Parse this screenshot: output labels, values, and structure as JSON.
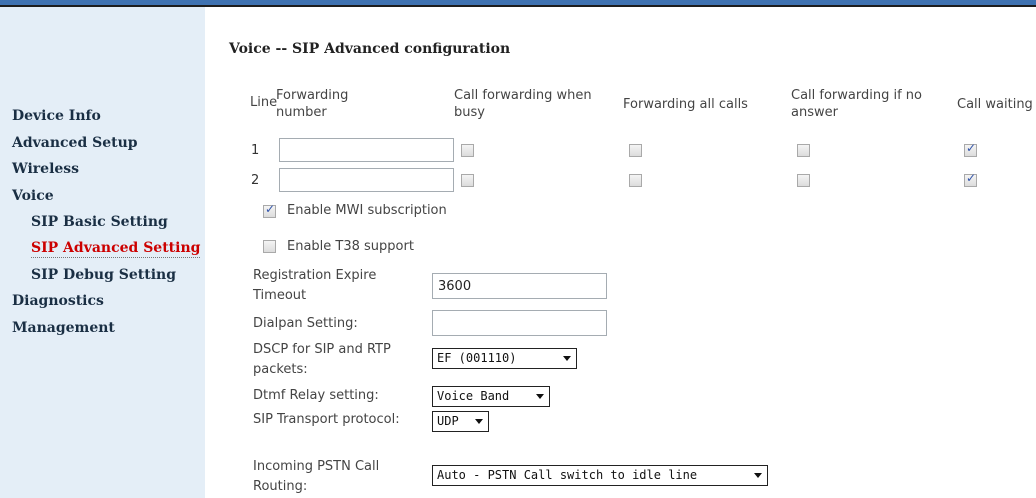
{
  "sidebar": {
    "items": [
      {
        "label": "Device Info"
      },
      {
        "label": "Advanced Setup"
      },
      {
        "label": "Wireless"
      },
      {
        "label": "Voice"
      },
      {
        "label": "SIP Basic Setting"
      },
      {
        "label": "SIP Advanced Setting"
      },
      {
        "label": "SIP Debug Setting"
      },
      {
        "label": "Diagnostics"
      },
      {
        "label": "Management"
      }
    ],
    "active": "SIP Advanced Setting"
  },
  "page": {
    "title": "Voice -- SIP Advanced configuration"
  },
  "forwarding_table": {
    "headers": {
      "line": "Line",
      "forwarding_number": [
        "Forwarding",
        "number"
      ],
      "busy": [
        "Call forwarding when",
        "busy"
      ],
      "all": "Forwarding all calls",
      "no_answer": [
        "Call forwarding if no",
        "answer"
      ],
      "waiting": "Call waiting"
    },
    "rows": [
      {
        "line": "1",
        "forwarding_number": "",
        "busy": false,
        "all": false,
        "no_answer": false,
        "waiting": true
      },
      {
        "line": "2",
        "forwarding_number": "",
        "busy": false,
        "all": false,
        "no_answer": false,
        "waiting": true
      }
    ]
  },
  "options": {
    "mwi": {
      "label": "Enable MWI subscription",
      "checked": true
    },
    "t38": {
      "label": "Enable T38 support",
      "checked": false
    }
  },
  "settings": {
    "registration_expire": {
      "label": [
        "Registration Expire",
        "Timeout"
      ],
      "value": "3600"
    },
    "dialplan": {
      "label": "Dialpan Setting:",
      "value": ""
    },
    "dscp": {
      "label": [
        "DSCP for SIP and RTP",
        "packets:"
      ],
      "value": "EF (001110)"
    },
    "dtmf": {
      "label": "Dtmf Relay setting:",
      "value": "Voice Band"
    },
    "transport": {
      "label": "SIP Transport protocol:",
      "value": "UDP"
    },
    "pstn_routing": {
      "label": [
        "Incoming PSTN Call",
        "Routing:"
      ],
      "value": "Auto - PSTN Call switch to idle line"
    }
  },
  "colors": {
    "sidebar_bg": "#e4eef7",
    "nav_text": "#1a2f44",
    "active_nav": "#cc0000",
    "top_bar": "#3f72b1"
  },
  "icons": {
    "check": "checkbox-check-icon",
    "dropdown": "chevron-down-icon"
  }
}
